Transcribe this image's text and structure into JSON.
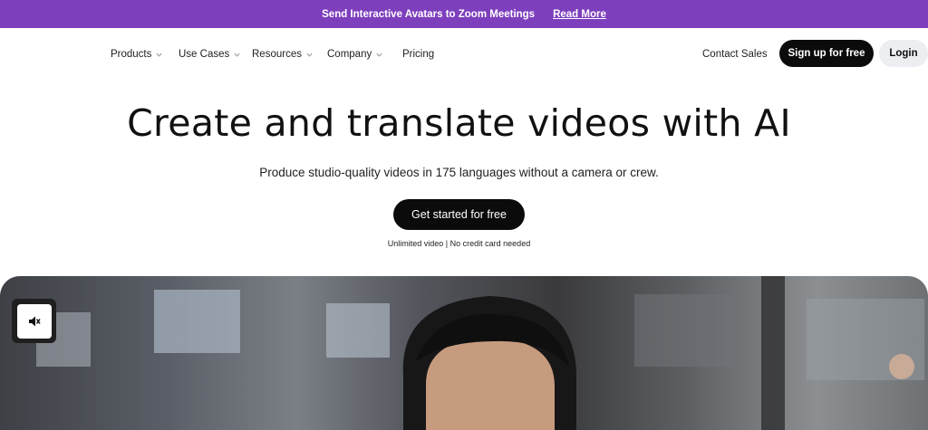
{
  "banner": {
    "message": "Send Interactive Avatars to Zoom Meetings",
    "link": "Read More",
    "bg_color": "#7e3fbd"
  },
  "nav": {
    "items": [
      {
        "label": "Products",
        "has_dropdown": true
      },
      {
        "label": "Use Cases",
        "has_dropdown": true
      },
      {
        "label": "Resources",
        "has_dropdown": true
      },
      {
        "label": "Company",
        "has_dropdown": true
      },
      {
        "label": "Pricing",
        "has_dropdown": false
      }
    ],
    "contact_sales": "Contact Sales",
    "signup": "Sign up for free",
    "login": "Login"
  },
  "hero": {
    "title": "Create and translate videos with AI",
    "subtitle": "Produce studio-quality videos in 175 languages without a camera or crew.",
    "cta": "Get started for free",
    "note": "Unlimited video | No credit card needed"
  },
  "video": {
    "mute_icon": "speaker-muted-icon"
  }
}
